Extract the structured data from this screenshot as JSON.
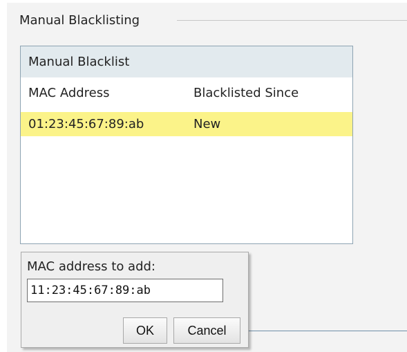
{
  "fieldset": {
    "legend": "Manual Blacklisting"
  },
  "blacklist": {
    "title": "Manual Blacklist",
    "columns": [
      "MAC Address",
      "Blacklisted Since"
    ],
    "rows": [
      {
        "mac": "01:23:45:67:89:ab",
        "since": "New",
        "highlighted": true
      }
    ]
  },
  "add_dialog": {
    "label": "MAC address to add:",
    "input_value": "11:23:45:67:89:ab",
    "ok_label": "OK",
    "cancel_label": "Cancel"
  },
  "colors": {
    "highlight_row": "#fbf389",
    "header_bg": "#e2eaee",
    "panel_bg": "#f3f3f3"
  }
}
